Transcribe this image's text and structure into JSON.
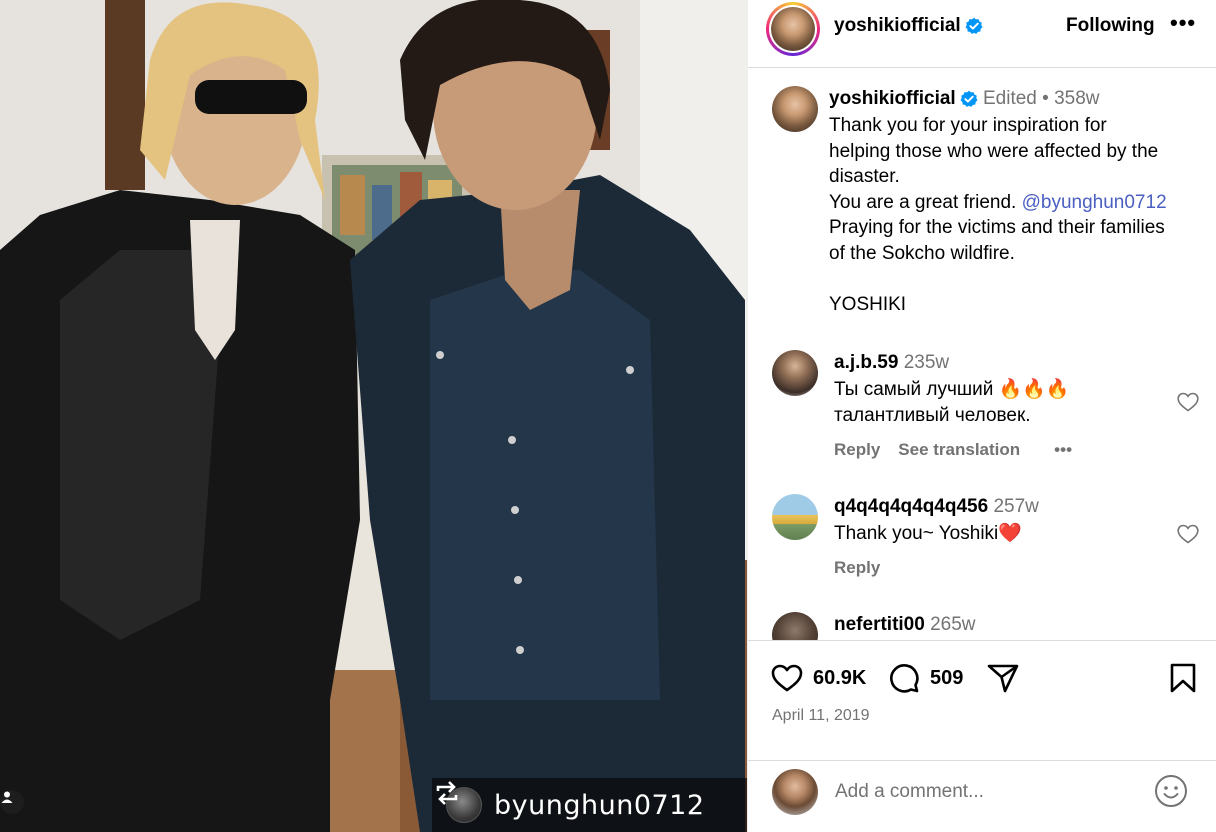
{
  "post": {
    "author": "yoshikiofficial",
    "follow_state": "Following",
    "more": "•••",
    "repost_handle": "byunghun0712"
  },
  "caption": {
    "username": "yoshikiofficial",
    "edited": "Edited",
    "separator": "•",
    "age": "358w",
    "lines": [
      "Thank you for your inspiration for",
      "helping those who were affected by the",
      "disaster.",
      "You are a great friend.",
      "Praying for the victims and their families",
      "of the Sokcho wildfire.",
      "",
      "YOSHIKI"
    ],
    "mention": "@byunghun0712"
  },
  "comments": [
    {
      "username": "a.j.b.59",
      "age": "235w",
      "lines": [
        "Ты самый лучший 🔥🔥🔥",
        "талантливый человек."
      ],
      "reply_label": "Reply",
      "translate_label": "See translation",
      "more": "•••"
    },
    {
      "username": "q4q4q4q4q4q456",
      "age": "257w",
      "lines": [
        "Thank you~ Yoshiki❤️"
      ],
      "reply_label": "Reply"
    },
    {
      "username": "nefertiti00",
      "age": "265w"
    }
  ],
  "actions": {
    "likes": "60.9K",
    "comments": "509",
    "date": "April 11, 2019"
  },
  "composer": {
    "placeholder": "Add a comment..."
  },
  "colors": {
    "verified_blue": "#0095f6",
    "mention_blue": "#4a5fc1",
    "secondary_text": "#737373",
    "heart_red": "#ed4956"
  },
  "icons": [
    "people-tag-icon",
    "repost-icon",
    "verified-icon",
    "more-icon",
    "heart-icon",
    "comment-icon",
    "share-icon",
    "bookmark-icon",
    "emoji-icon"
  ]
}
